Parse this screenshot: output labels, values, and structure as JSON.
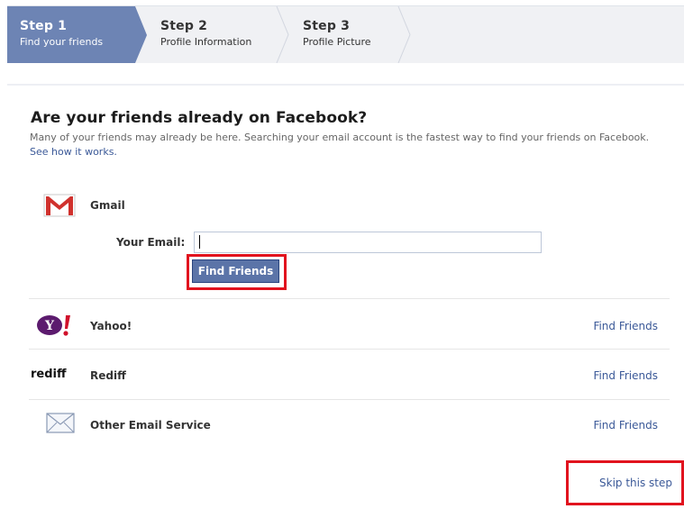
{
  "steps": [
    {
      "title": "Step 1",
      "subtitle": "Find your friends",
      "active": true
    },
    {
      "title": "Step 2",
      "subtitle": "Profile Information",
      "active": false
    },
    {
      "title": "Step 3",
      "subtitle": "Profile Picture",
      "active": false
    }
  ],
  "heading": "Are your friends already on Facebook?",
  "intro": {
    "text": "Many of your friends may already be here. Searching your email account is the fastest way to find your friends on Facebook.",
    "link": "See how it works."
  },
  "gmail": {
    "name": "Gmail",
    "email_label": "Your Email:",
    "email_value": "",
    "button": "Find Friends"
  },
  "providers": [
    {
      "name": "Yahoo!",
      "link": "Find Friends",
      "icon": "yahoo-icon"
    },
    {
      "name": "Rediff",
      "link": "Find Friends",
      "icon": "rediff-logo",
      "logo_text": "rediff"
    },
    {
      "name": "Other Email Service",
      "link": "Find Friends",
      "icon": "envelope-icon"
    }
  ],
  "skip": "Skip this step",
  "colors": {
    "active_step": "#6d84b4",
    "link": "#3b5998",
    "button": "#5b74a8",
    "highlight": "#e1131e"
  }
}
